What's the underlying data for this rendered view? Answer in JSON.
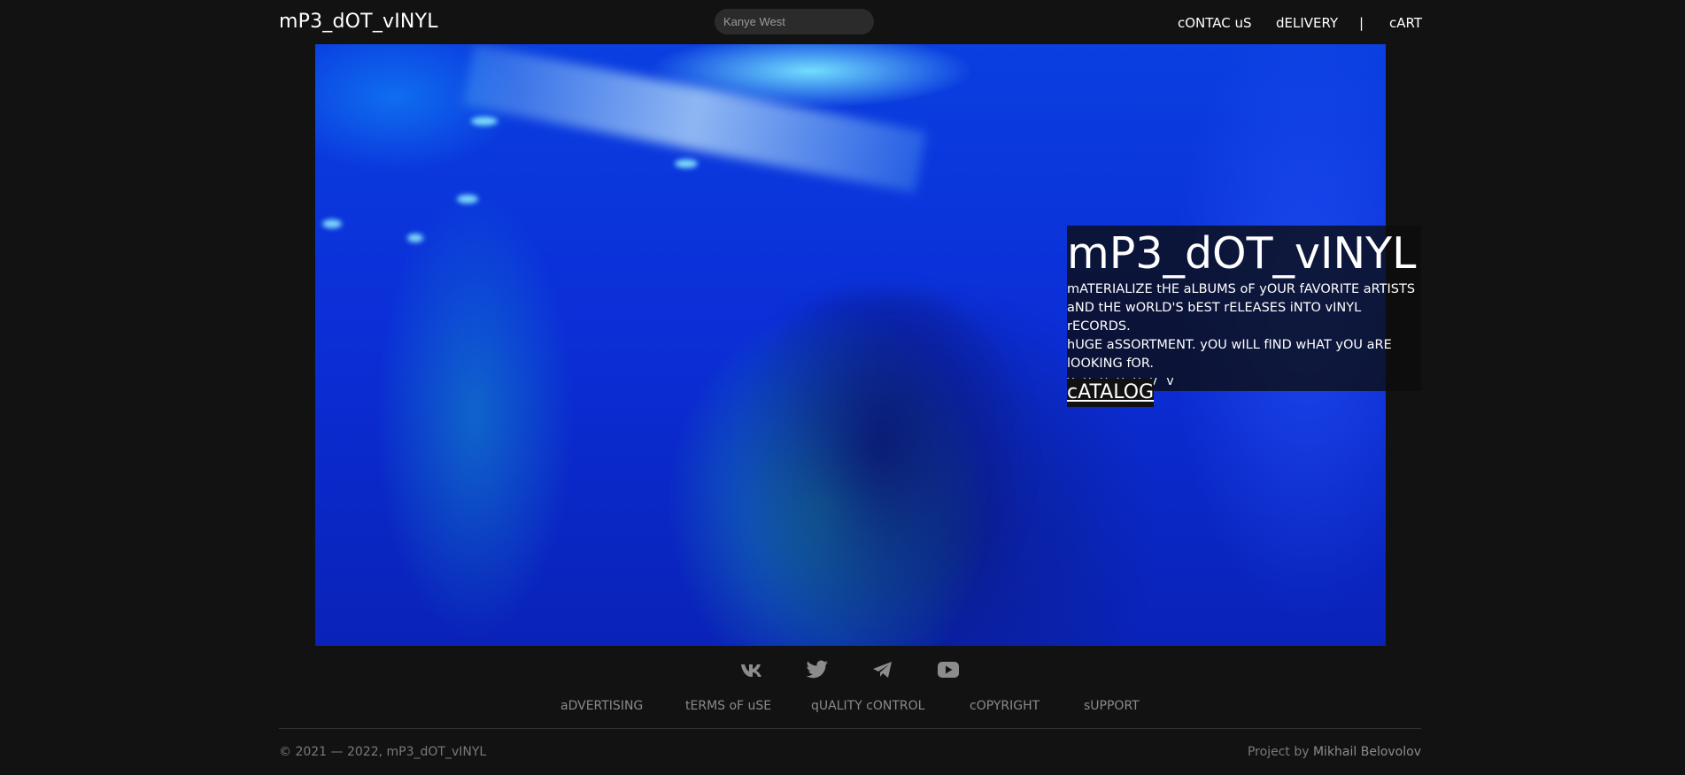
{
  "header": {
    "logo": "mP3_dOT_vINYL",
    "search": {
      "value": "Kanye West",
      "placeholder": "Kanye West"
    },
    "nav": {
      "contact": "cONTAC uS",
      "delivery": "dELIVERY",
      "separator": "|",
      "cart": "cART"
    }
  },
  "hero": {
    "title": "mP3_dOT_vINYL",
    "description_lines": [
      "mATERIALIZE tHE aLBUMS oF yOUR fAVORITE aRTISTS",
      "aND tHE wORLD'S bEST rELEASES iNTO vINYL rECORDS.",
      "hUGE aSSORTMENT. yOU wILL fIND wHAT yOU aRE",
      "lOOKING fOR."
    ],
    "arrows": "v v v v v v v",
    "catalog": "cATALOG"
  },
  "footer": {
    "socials": [
      "vk-icon",
      "twitter-icon",
      "telegram-icon",
      "youtube-icon"
    ],
    "links": {
      "advertising": "aDVERTISING",
      "terms": "tERMS oF uSE",
      "quality": "qUALITY cONTROL",
      "copyright": "cOPYRIGHT",
      "support": "sUPPORT"
    },
    "copyright": "© 2021 — 2022, mP3_dOT_vINYL",
    "credit_prefix": "Project by ",
    "credit_name": "Mikhail Belovolov"
  },
  "colors": {
    "background": "#121212",
    "text": "#ffffff",
    "muted": "#8a8a8a",
    "hero_blue": "#0b2fd8"
  }
}
